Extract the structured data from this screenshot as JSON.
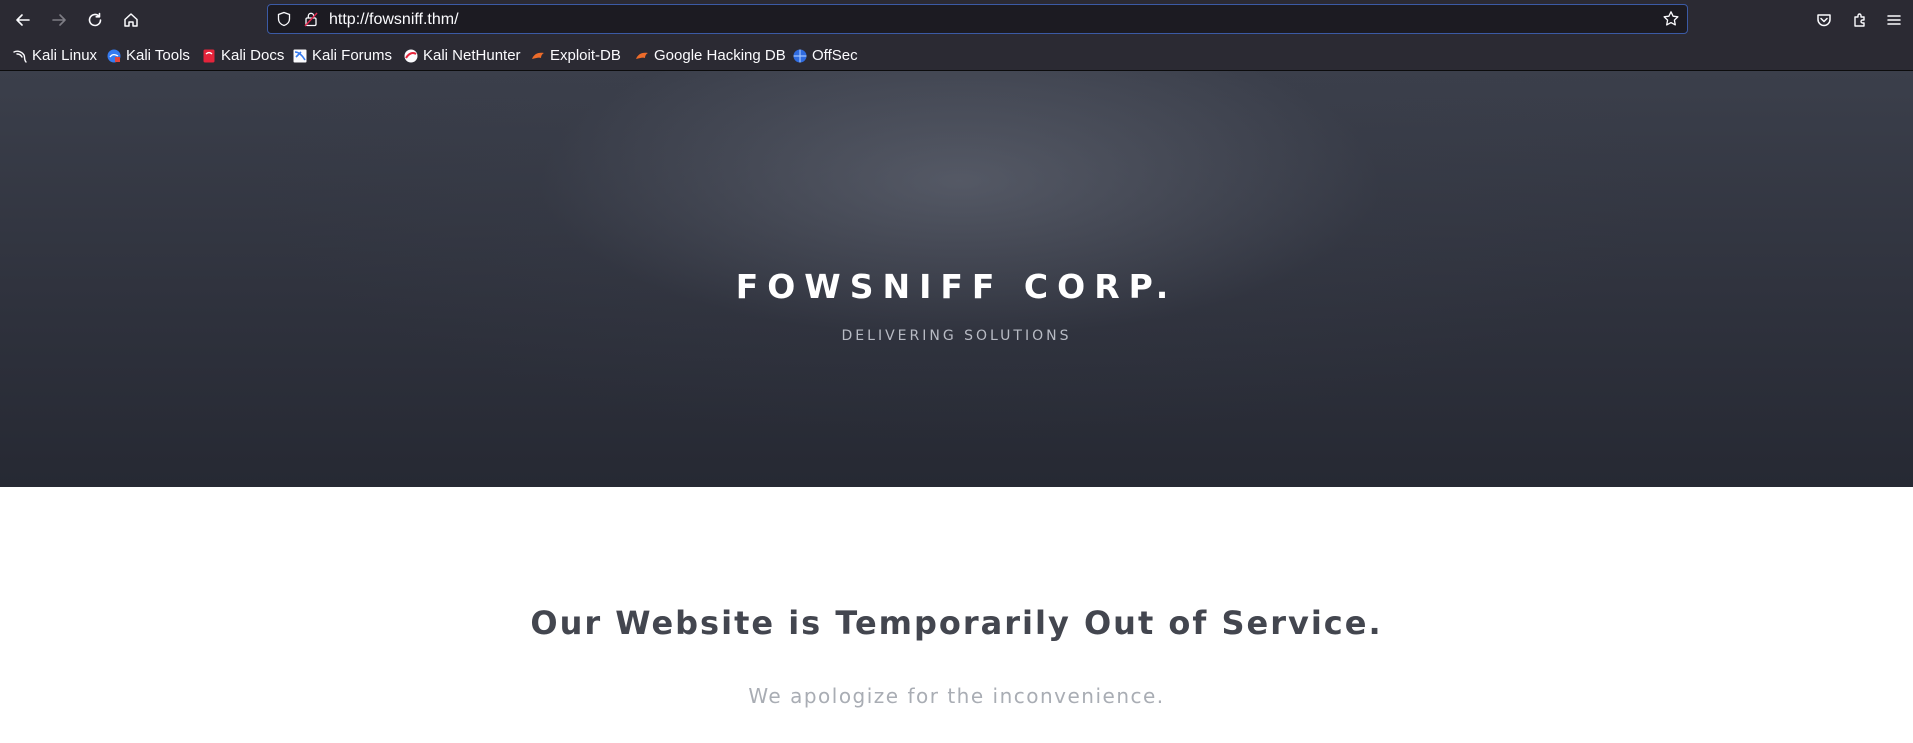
{
  "browser": {
    "url": "http://fowsniff.thm/",
    "bookmarks": [
      {
        "label": "Kali Linux",
        "icon": "kali-dragon-icon"
      },
      {
        "label": "Kali Tools",
        "icon": "kali-tools-icon"
      },
      {
        "label": "Kali Docs",
        "icon": "kali-docs-icon"
      },
      {
        "label": "Kali Forums",
        "icon": "kali-forums-icon"
      },
      {
        "label": "Kali NetHunter",
        "icon": "nethunter-icon"
      },
      {
        "label": "Exploit-DB",
        "icon": "exploit-db-icon"
      },
      {
        "label": "Google Hacking DB",
        "icon": "ghdb-icon"
      },
      {
        "label": "OffSec",
        "icon": "offsec-icon"
      }
    ],
    "colors": {
      "chrome": "#2b2a33",
      "urlbar": "#1c1b22",
      "focus": "#3b5aa5"
    }
  },
  "hero": {
    "title": "FOWSNIFF CORP.",
    "subtitle": "DELIVERING SOLUTIONS"
  },
  "main": {
    "heading": "Our Website is Temporarily Out of Service.",
    "subheading": "We apologize for the inconvenience."
  }
}
